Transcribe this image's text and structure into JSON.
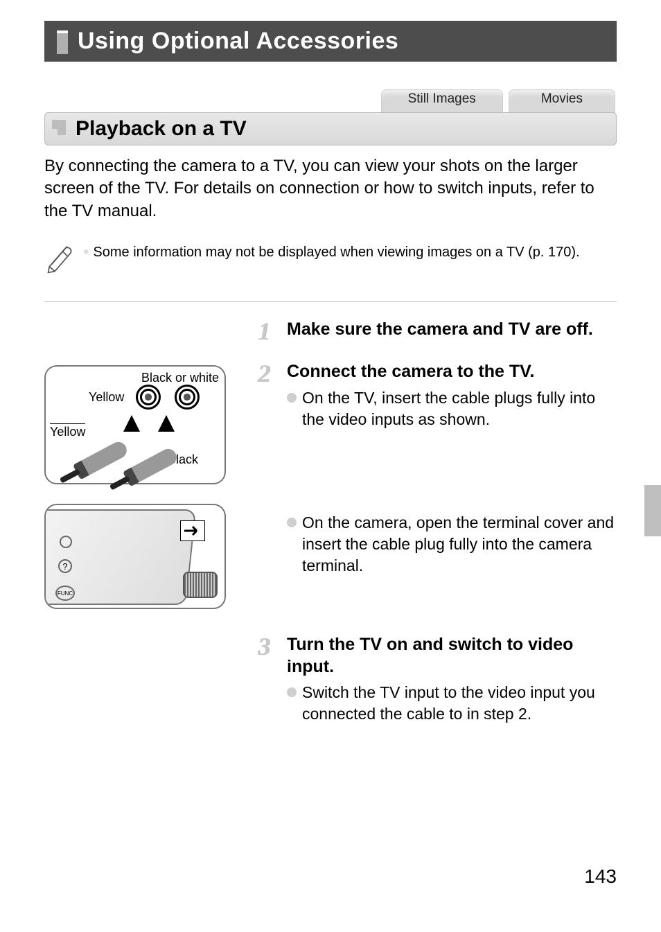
{
  "chapter": {
    "title": "Using Optional Accessories"
  },
  "tabs": {
    "still": "Still Images",
    "movies": "Movies"
  },
  "section": {
    "title": "Playback on a TV"
  },
  "intro": "By connecting the camera to a TV, you can view your shots on the larger screen of the TV. For details on connection or how to switch inputs, refer to the TV manual.",
  "note": "Some information may not be displayed when viewing images on a TV (p. 170).",
  "figure1": {
    "label_black_or_white": "Black or white",
    "label_yellow_top": "Yellow",
    "label_yellow_bottom": "Yellow",
    "label_black": "Black"
  },
  "steps": [
    {
      "num": "1",
      "title": "Make sure the camera and TV are off.",
      "bullets": []
    },
    {
      "num": "2",
      "title": "Connect the camera to the TV.",
      "bullets": [
        "On the TV, insert the cable plugs fully into the video inputs as shown.",
        "On the camera, open the terminal cover and insert the cable plug fully into the camera terminal."
      ]
    },
    {
      "num": "3",
      "title": "Turn the TV on and switch to video input.",
      "bullets": [
        "Switch the TV input to the video input you connected the cable to in step 2."
      ]
    }
  ],
  "page_number": "143"
}
